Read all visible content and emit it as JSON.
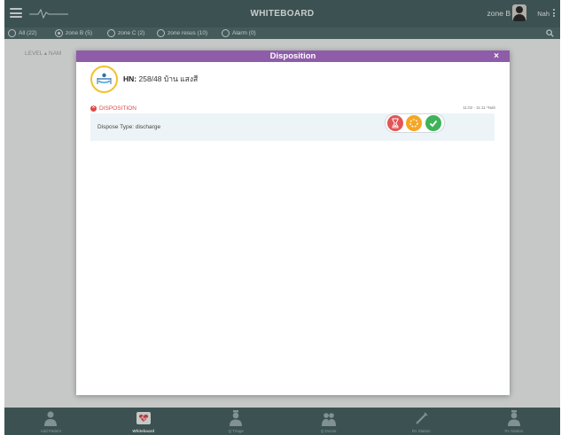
{
  "app": {
    "title": "WHITEBOARD",
    "zone_label": "zone B",
    "user_name": "Nah"
  },
  "filters": [
    {
      "label": "All (22)",
      "checked": false
    },
    {
      "label": "zone B (5)",
      "checked": true
    },
    {
      "label": "zone C (2)",
      "checked": false
    },
    {
      "label": "zone resus (10)",
      "checked": false
    },
    {
      "label": "Alarm (0)",
      "checked": false
    }
  ],
  "list_header": "LEVEL ▴  NAM",
  "bottom_nav": [
    {
      "label": "Add Patient",
      "icon": "doctor-icon",
      "active": false
    },
    {
      "label": "Whiteboard",
      "icon": "heart-pulse-icon",
      "active": true
    },
    {
      "label": "Q Triage",
      "icon": "nurse-icon",
      "active": false
    },
    {
      "label": "Q Doctor",
      "icon": "doctors-group-icon",
      "active": false
    },
    {
      "label": "Rx Station",
      "icon": "syringe-icon",
      "active": false
    },
    {
      "label": "Px Station",
      "icon": "nurse-icon",
      "active": false
    }
  ],
  "modal": {
    "title": "Disposition",
    "close": "×",
    "patient": {
      "hn_label": "HN:",
      "hn_value": "258/48  บ้าน แสงสี"
    },
    "section_title": "DISPOSITION",
    "timestamp": "11:02 - 11:11 *Nah",
    "dispose_label": "Dispose Type: discharge"
  },
  "colors": {
    "topbar": "#4a6464",
    "modal_header": "#8e5ca8",
    "status_wait": "#e25555",
    "status_progress": "#f5a623",
    "status_done": "#3eb35a",
    "section_accent": "#e04848"
  }
}
